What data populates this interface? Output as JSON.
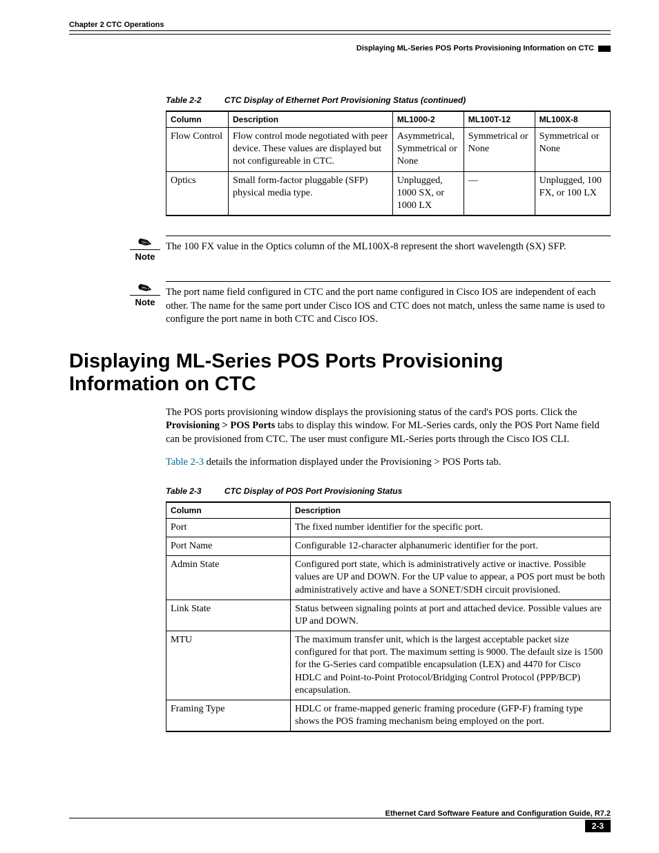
{
  "header": {
    "chapter": "Chapter 2    CTC Operations",
    "subheader": "Displaying ML-Series POS Ports Provisioning Information on CTC"
  },
  "table22": {
    "caption_num": "Table 2-2",
    "caption_title": "CTC Display of Ethernet Port Provisioning Status (continued)",
    "headers": {
      "c0": "Column",
      "c1": "Description",
      "c2": "ML1000-2",
      "c3": "ML100T-12",
      "c4": "ML100X-8"
    },
    "row0": {
      "c0": "Flow Control",
      "c1": "Flow control mode negotiated with peer device. These values are displayed but not configureable in CTC.",
      "c2": "Asymmetrical, Symmetrical or None",
      "c3": "Symmetrical or None",
      "c4": "Symmetrical or None"
    },
    "row1": {
      "c0": "Optics",
      "c1": "Small form-factor pluggable (SFP) physical media type.",
      "c2": "Unplugged, 1000 SX, or 1000 LX",
      "c3": "—",
      "c4": "Unplugged, 100 FX, or 100 LX"
    }
  },
  "notes": {
    "label": "Note",
    "n1": "The 100 FX value in the Optics column of the ML100X-8 represent the short wavelength (SX) SFP.",
    "n2": "The port name field configured in CTC and the port name configured in Cisco IOS are independent of each other. The name for the same port under Cisco IOS and CTC does not match, unless the same name is used to configure the port name in both CTC and Cisco IOS."
  },
  "section": {
    "title": "Displaying ML-Series POS Ports Provisioning Information on CTC",
    "p1a": "The POS ports provisioning window displays the provisioning status of the card's POS ports. Click the ",
    "p1b": "Provisioning > POS Ports",
    "p1c": " tabs to display this window. For ML-Series cards, only the POS Port Name field can be provisioned from CTC. The user must configure ML-Series ports through the Cisco IOS CLI.",
    "p2a": "Table 2-3",
    "p2b": " details the information displayed under the Provisioning > POS Ports tab."
  },
  "table23": {
    "caption_num": "Table 2-3",
    "caption_title": "CTC Display of POS Port Provisioning Status",
    "headers": {
      "c0": "Column",
      "c1": "Description"
    },
    "r0": {
      "c0": "Port",
      "c1": "The fixed number identifier for the specific port."
    },
    "r1": {
      "c0": "Port Name",
      "c1": "Configurable 12-character alphanumeric identifier for the port."
    },
    "r2": {
      "c0": "Admin State",
      "c1": "Configured port state, which is administratively active or inactive. Possible values are UP and DOWN. For the UP value to appear, a POS port must be both administratively active and have a SONET/SDH circuit provisioned."
    },
    "r3": {
      "c0": "Link State",
      "c1": "Status between signaling points at port and attached device. Possible values are UP and DOWN."
    },
    "r4": {
      "c0": "MTU",
      "c1": "The maximum transfer unit, which is the largest acceptable packet size configured for that port. The maximum setting is 9000. The default size is 1500 for the G-Series card compatible encapsulation (LEX) and 4470 for Cisco HDLC and Point-to-Point Protocol/Bridging Control Protocol (PPP/BCP) encapsulation."
    },
    "r5": {
      "c0": "Framing Type",
      "c1": "HDLC or frame-mapped generic framing procedure (GFP-F) framing type shows the POS framing mechanism being employed on the port."
    }
  },
  "footer": {
    "guide": "Ethernet Card Software Feature and Configuration Guide, R7.2",
    "pagenum": "2-3"
  }
}
